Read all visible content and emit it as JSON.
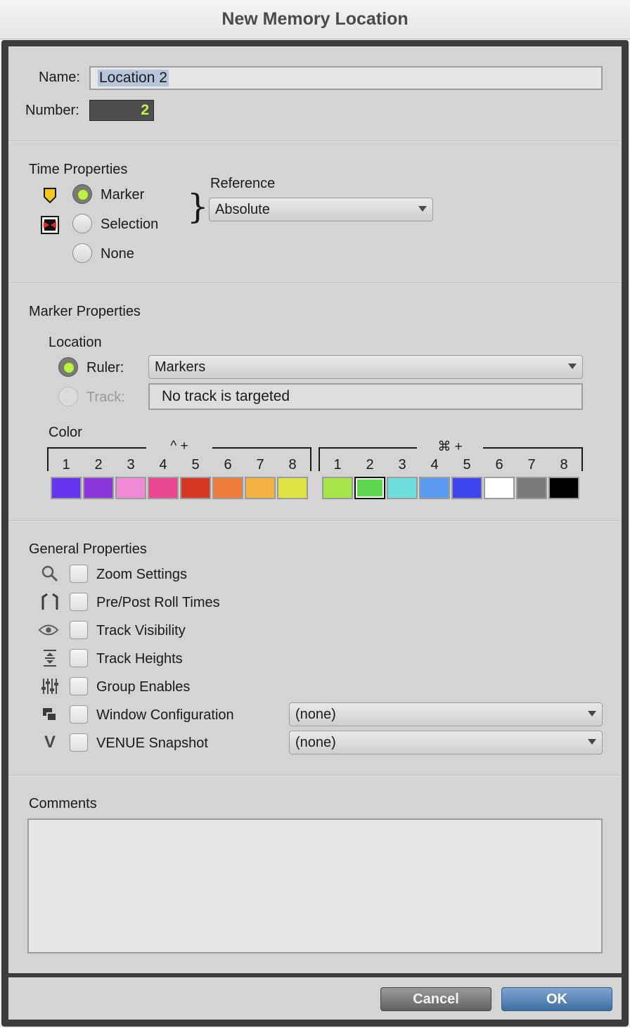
{
  "window": {
    "title": "New Memory Location"
  },
  "name_field": {
    "label": "Name:",
    "value": "Location 2"
  },
  "number_field": {
    "label": "Number:",
    "value": "2"
  },
  "time_properties": {
    "heading": "Time Properties",
    "options": [
      {
        "label": "Marker",
        "selected": true
      },
      {
        "label": "Selection",
        "selected": false
      },
      {
        "label": "None",
        "selected": false
      }
    ],
    "reference_label": "Reference",
    "reference_value": "Absolute",
    "brace": "}"
  },
  "marker_properties": {
    "heading": "Marker Properties",
    "location_label": "Location",
    "ruler_label": "Ruler:",
    "ruler_value": "Markers",
    "track_label": "Track:",
    "track_value": "No track is targeted",
    "color_label": "Color",
    "group1_modifier": "^ +",
    "group2_modifier": "⌘ +",
    "numbers": [
      "1",
      "2",
      "3",
      "4",
      "5",
      "6",
      "7",
      "8"
    ],
    "group1_colors": [
      "#6435f0",
      "#8c35d8",
      "#ee8ad6",
      "#e8468e",
      "#d63626",
      "#ee7c3c",
      "#f4b240",
      "#dee242"
    ],
    "group2_colors": [
      "#a4e448",
      "#5cd64c",
      "#6cdedc",
      "#5c9cf0",
      "#3e44ee",
      "#ffffff",
      "#7a7a7a",
      "#000000"
    ],
    "selected_group": 2,
    "selected_index": 1
  },
  "general_properties": {
    "heading": "General Properties",
    "items": [
      {
        "label": "Zoom Settings",
        "icon": "magnifier-icon"
      },
      {
        "label": "Pre/Post Roll Times",
        "icon": "preroll-icon"
      },
      {
        "label": "Track Visibility",
        "icon": "eye-icon"
      },
      {
        "label": "Track Heights",
        "icon": "track-heights-icon"
      },
      {
        "label": "Group Enables",
        "icon": "faders-icon"
      },
      {
        "label": "Window Configuration",
        "icon": "windows-icon"
      },
      {
        "label": "VENUE Snapshot",
        "icon": "venue-icon"
      }
    ],
    "window_config_value": "(none)",
    "venue_value": "(none)",
    "venue_glyph": "V"
  },
  "comments": {
    "heading": "Comments",
    "value": ""
  },
  "buttons": {
    "cancel": "Cancel",
    "ok": "OK"
  }
}
